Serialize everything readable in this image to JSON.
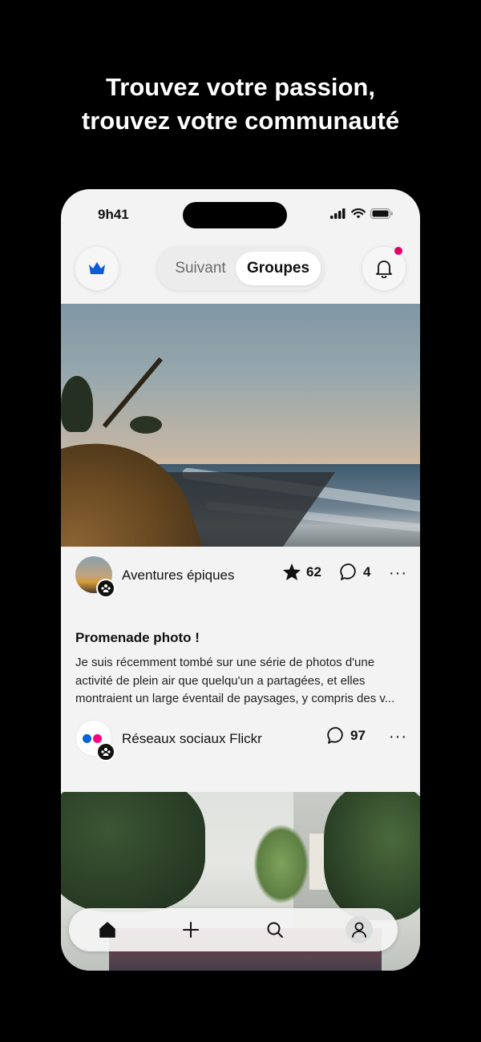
{
  "headline": {
    "line1": "Trouvez votre passion,",
    "line2": "trouvez votre communauté"
  },
  "status_bar": {
    "time": "9h41",
    "icons": [
      "signal-icon",
      "wifi-icon",
      "battery-icon"
    ]
  },
  "top_bar": {
    "left_icon": "crown-icon",
    "tabs": [
      {
        "label": "Suivant",
        "active": false
      },
      {
        "label": "Groupes",
        "active": true
      }
    ],
    "right_icon": "bell-icon",
    "has_notification": true
  },
  "feed": {
    "post1": {
      "group_name": "Aventures épiques",
      "stars": "62",
      "comments": "4",
      "more": "···"
    },
    "post2": {
      "title": "Promenade photo !",
      "body": "Je suis récemment tombé sur une série de photos d'une activité de plein air que quelqu'un a partagées, et elles montraient un large éventail de paysages, y compris des v...",
      "group_name": "Réseaux sociaux Flickr",
      "comments": "97",
      "more": "···"
    }
  },
  "bottom_nav": {
    "items": [
      "home-icon",
      "add-icon",
      "search-icon",
      "profile-icon"
    ]
  },
  "colors": {
    "accent_blue": "#0063dc",
    "accent_pink": "#ff0084",
    "notification": "#e4006b"
  }
}
